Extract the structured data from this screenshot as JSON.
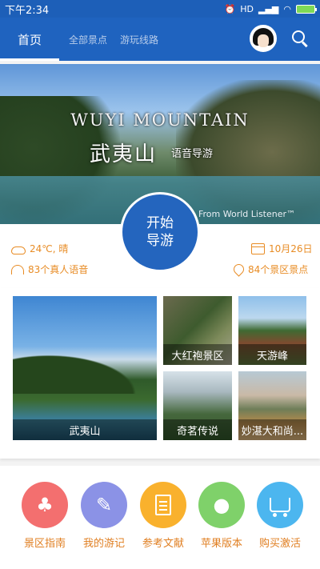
{
  "status_bar": {
    "time": "下午2:34",
    "network": "HD",
    "icons": [
      "alarm-icon",
      "signal-icon",
      "wifi-icon",
      "battery-icon"
    ]
  },
  "nav": {
    "tabs": [
      {
        "label": "首页",
        "active": true
      },
      {
        "label": "全部景点",
        "active": false
      },
      {
        "label": "游玩线路",
        "active": false
      }
    ],
    "accent_color": "#1f63bf"
  },
  "banner": {
    "title_en": "WUYI MOUNTAIN",
    "title_cn": "武夷山",
    "subtitle_cn": "语音导游",
    "credit": "From World Listener™"
  },
  "start_button": {
    "line1": "开始",
    "line2": "导游",
    "color": "#2465be"
  },
  "info": {
    "weather": "24℃, 晴",
    "date": "10月26日",
    "voices": "83个真人语音",
    "spots": "84个景区景点",
    "color": "#e88c25"
  },
  "attractions": [
    {
      "name": "武夷山"
    },
    {
      "name": "大红袍景区"
    },
    {
      "name": "天游峰"
    },
    {
      "name": "奇茗传说"
    },
    {
      "name": "妙湛大和尚..."
    }
  ],
  "menu": [
    {
      "label": "景区指南",
      "color": "#f36f6f",
      "icon": "tree-icon"
    },
    {
      "label": "我的游记",
      "color": "#8b92e6",
      "icon": "notes-icon"
    },
    {
      "label": "参考文献",
      "color": "#f9b12d",
      "icon": "document-icon"
    },
    {
      "label": "苹果版本",
      "color": "#7fd16a",
      "icon": "apple-icon"
    },
    {
      "label": "购买激活",
      "color": "#4cb6ef",
      "icon": "cart-icon"
    }
  ]
}
